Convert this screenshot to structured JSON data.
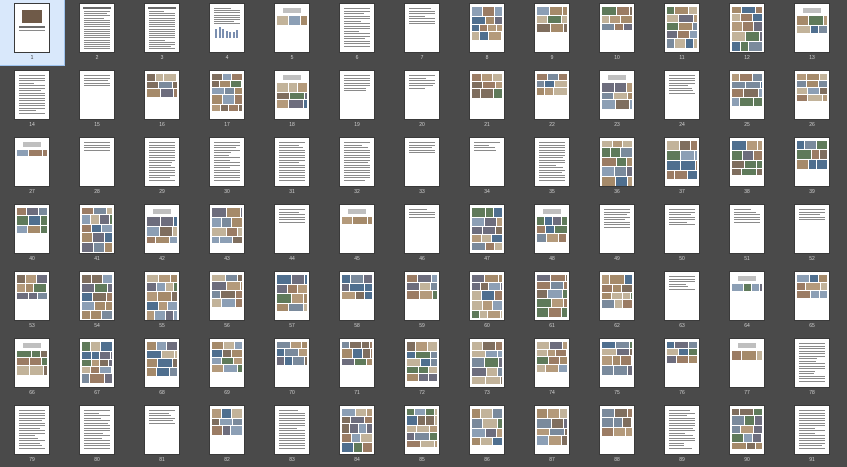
{
  "view": "page-thumbnails",
  "selected_page": 1,
  "colors": {
    "background": "#4a4a4a",
    "page": "#ffffff",
    "selection": "#d9e8fb",
    "number": "#d0d0d0"
  },
  "pages": [
    {
      "n": 1,
      "k": "cover",
      "selected": true
    },
    {
      "n": 2,
      "k": "table"
    },
    {
      "n": 3,
      "k": "table"
    },
    {
      "n": 4,
      "k": "tablechart"
    },
    {
      "n": 5,
      "k": "titleblank"
    },
    {
      "n": 6,
      "k": "text"
    },
    {
      "n": 7,
      "k": "textshort"
    },
    {
      "n": 8,
      "k": "photos"
    },
    {
      "n": 9,
      "k": "photos"
    },
    {
      "n": 10,
      "k": "photos"
    },
    {
      "n": 11,
      "k": "photos"
    },
    {
      "n": 12,
      "k": "photos"
    },
    {
      "n": 13,
      "k": "titlephoto"
    },
    {
      "n": 14,
      "k": "text"
    },
    {
      "n": 15,
      "k": "textshort"
    },
    {
      "n": 16,
      "k": "photos"
    },
    {
      "n": 17,
      "k": "photos"
    },
    {
      "n": 18,
      "k": "titlephoto"
    },
    {
      "n": 19,
      "k": "textshort"
    },
    {
      "n": 20,
      "k": "textshort"
    },
    {
      "n": 21,
      "k": "photos"
    },
    {
      "n": 22,
      "k": "photos"
    },
    {
      "n": 23,
      "k": "titlephoto"
    },
    {
      "n": 24,
      "k": "textshort"
    },
    {
      "n": 25,
      "k": "photos"
    },
    {
      "n": 26,
      "k": "photos"
    },
    {
      "n": 27,
      "k": "titlephoto"
    },
    {
      "n": 28,
      "k": "textshort"
    },
    {
      "n": 29,
      "k": "text"
    },
    {
      "n": 30,
      "k": "text"
    },
    {
      "n": 31,
      "k": "text"
    },
    {
      "n": 32,
      "k": "text"
    },
    {
      "n": 33,
      "k": "textshort"
    },
    {
      "n": 34,
      "k": "textshort"
    },
    {
      "n": 35,
      "k": "text"
    },
    {
      "n": 36,
      "k": "photos"
    },
    {
      "n": 37,
      "k": "photos"
    },
    {
      "n": 38,
      "k": "photos"
    },
    {
      "n": 39,
      "k": "photos"
    },
    {
      "n": 40,
      "k": "photos"
    },
    {
      "n": 41,
      "k": "photos"
    },
    {
      "n": 42,
      "k": "titlephoto"
    },
    {
      "n": 43,
      "k": "photos"
    },
    {
      "n": 44,
      "k": "textshort"
    },
    {
      "n": 45,
      "k": "titlephoto"
    },
    {
      "n": 46,
      "k": "textshort"
    },
    {
      "n": 47,
      "k": "photos"
    },
    {
      "n": 48,
      "k": "titlephoto"
    },
    {
      "n": 49,
      "k": "textshort"
    },
    {
      "n": 50,
      "k": "textshort"
    },
    {
      "n": 51,
      "k": "textshort"
    },
    {
      "n": 52,
      "k": "textshort"
    },
    {
      "n": 53,
      "k": "photos"
    },
    {
      "n": 54,
      "k": "photos"
    },
    {
      "n": 55,
      "k": "photos"
    },
    {
      "n": 56,
      "k": "photos"
    },
    {
      "n": 57,
      "k": "photos"
    },
    {
      "n": 58,
      "k": "photos"
    },
    {
      "n": 59,
      "k": "photos"
    },
    {
      "n": 60,
      "k": "photos"
    },
    {
      "n": 61,
      "k": "photos"
    },
    {
      "n": 62,
      "k": "photos"
    },
    {
      "n": 63,
      "k": "textshort"
    },
    {
      "n": 64,
      "k": "titlephoto"
    },
    {
      "n": 65,
      "k": "photos"
    },
    {
      "n": 66,
      "k": "titlephoto"
    },
    {
      "n": 67,
      "k": "photos"
    },
    {
      "n": 68,
      "k": "photos"
    },
    {
      "n": 69,
      "k": "photos"
    },
    {
      "n": 70,
      "k": "photos"
    },
    {
      "n": 71,
      "k": "photos"
    },
    {
      "n": 72,
      "k": "photos"
    },
    {
      "n": 73,
      "k": "photos"
    },
    {
      "n": 74,
      "k": "photos"
    },
    {
      "n": 75,
      "k": "photos"
    },
    {
      "n": 76,
      "k": "photos"
    },
    {
      "n": 77,
      "k": "titlephoto"
    },
    {
      "n": 78,
      "k": "text"
    },
    {
      "n": 79,
      "k": "text"
    },
    {
      "n": 80,
      "k": "text"
    },
    {
      "n": 81,
      "k": "textshort"
    },
    {
      "n": 82,
      "k": "photos"
    },
    {
      "n": 83,
      "k": "text"
    },
    {
      "n": 84,
      "k": "photos"
    },
    {
      "n": 85,
      "k": "photos"
    },
    {
      "n": 86,
      "k": "photos"
    },
    {
      "n": 87,
      "k": "photos"
    },
    {
      "n": 88,
      "k": "photos"
    },
    {
      "n": 89,
      "k": "text"
    },
    {
      "n": 90,
      "k": "photos"
    },
    {
      "n": 91,
      "k": "text"
    }
  ]
}
